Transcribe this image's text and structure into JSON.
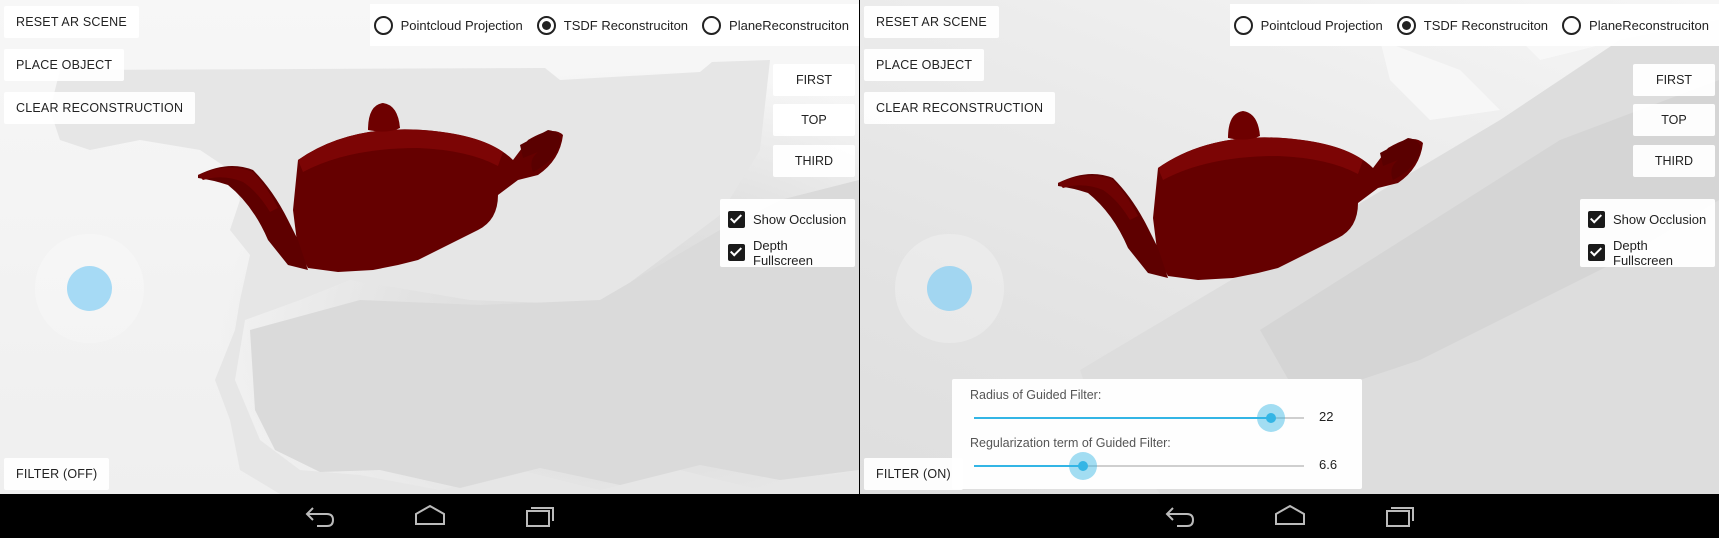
{
  "panels": [
    {
      "reset_label": "RESET AR SCENE",
      "place_label": "PLACE OBJECT",
      "clear_label": "CLEAR RECONSTRUCTION",
      "filter_label": "FILTER (OFF)",
      "camera": {
        "first": "FIRST",
        "top": "TOP",
        "third": "THIRD"
      },
      "modes": [
        {
          "label": "Pointcloud Projection",
          "checked": false
        },
        {
          "label": "TSDF Reconstruciton",
          "checked": true
        },
        {
          "label": "PlaneReconstruciton",
          "checked": false
        }
      ],
      "options": [
        {
          "label": "Show Occlusion",
          "checked": true
        },
        {
          "label": "Depth Fullscreen",
          "checked": true
        }
      ]
    },
    {
      "reset_label": "RESET AR SCENE",
      "place_label": "PLACE OBJECT",
      "clear_label": "CLEAR RECONSTRUCTION",
      "filter_label": "FILTER (ON)",
      "camera": {
        "first": "FIRST",
        "top": "TOP",
        "third": "THIRD"
      },
      "modes": [
        {
          "label": "Pointcloud Projection",
          "checked": false
        },
        {
          "label": "TSDF Reconstruciton",
          "checked": true
        },
        {
          "label": "PlaneReconstruciton",
          "checked": false
        }
      ],
      "options": [
        {
          "label": "Show Occlusion",
          "checked": true
        },
        {
          "label": "Depth Fullscreen",
          "checked": true
        }
      ],
      "guided_filter": {
        "radius_label": "Radius of Guided Filter:",
        "radius_value": "22",
        "radius_fraction": 0.9,
        "reg_label": "Regularization term of Guided Filter:",
        "reg_value": "6.6",
        "reg_fraction": 0.33
      }
    }
  ],
  "nav": {
    "back_icon": "back-icon",
    "home_icon": "home-icon",
    "recents_icon": "recents-icon"
  },
  "colors": {
    "accent": "#33b5e5",
    "teapot": "#6b0000",
    "joystick": "#8cd2f5"
  }
}
